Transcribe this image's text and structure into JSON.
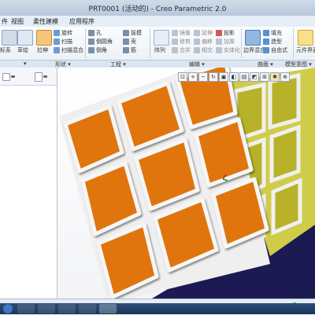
{
  "window": {
    "title": "PRT0001 (活动的) - Creo Parametric 2.0"
  },
  "menu": {
    "tabs": [
      "件",
      "视图",
      "柔性建模",
      "应用程序"
    ]
  },
  "ribbon": {
    "shape_tools": [
      "旋转",
      "扫描",
      "扫描混合"
    ],
    "edit_tools": [
      "孔",
      "倒圆角",
      "倒角"
    ],
    "edit_tools2": [
      "拔模",
      "壳",
      "筋"
    ],
    "extrude_label": "拉伸",
    "sketch_label": "草绘",
    "coord_label": "标系",
    "pattern_label": "阵列",
    "edit_group": [
      "镜像",
      "延伸",
      "投影",
      "修剪",
      "偏移",
      "加厚",
      "合并",
      "相交",
      "实体化"
    ],
    "surface_tools": [
      "填充",
      "造型",
      "自由式"
    ],
    "boundary_label": "边界混合",
    "assign_label": "元件界面",
    "groups": [
      "▾",
      "形状 ▾",
      "工程 ▾",
      "编辑 ▾",
      "曲面 ▾",
      "模型意图 ▾"
    ]
  },
  "status": {
    "indicator": "≡"
  },
  "colors": {
    "orange": "#e07410",
    "olive": "#b7b22a",
    "navy": "#1c1a52",
    "frame": "#f2f2f2",
    "accent": "#1f6fc5"
  }
}
